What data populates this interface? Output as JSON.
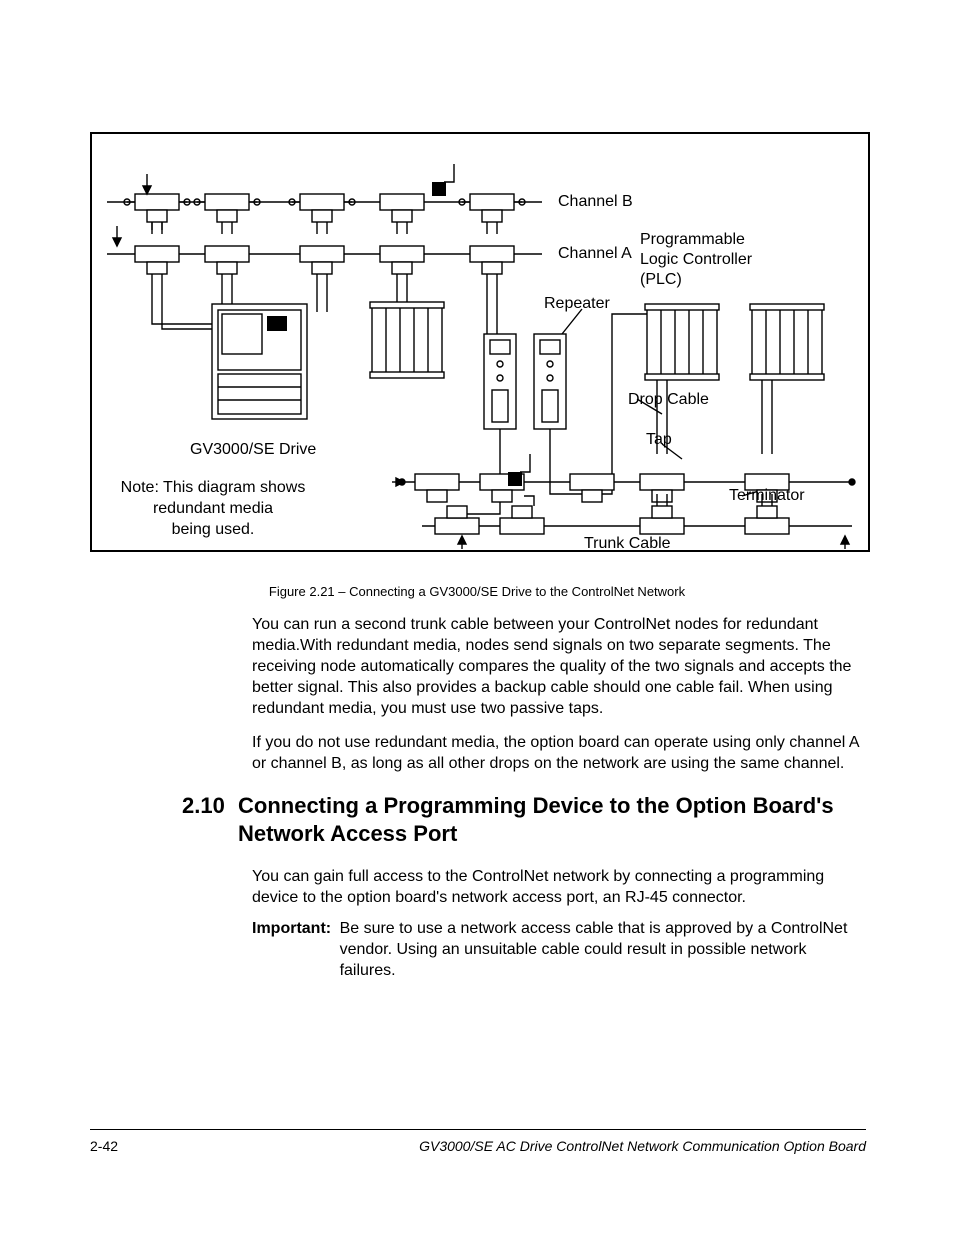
{
  "figure": {
    "labels": {
      "channel_b": "Channel B",
      "channel_a": "Channel A",
      "plc": "Programmable\nLogic Controller\n(PLC)",
      "repeater": "Repeater",
      "drop_cable": "Drop Cable",
      "tap": "Tap",
      "terminator": "Terminator",
      "trunk_cable": "Trunk Cable",
      "drive": "GV3000/SE Drive"
    },
    "note": "Note: This diagram shows\nredundant media\nbeing used.",
    "caption": "Figure 2.21 – Connecting a GV3000/SE Drive to the ControlNet Network"
  },
  "paragraphs": {
    "p1": "You can run a second trunk cable between your ControlNet nodes for redundant media.With redundant media, nodes send signals on two separate segments. The receiving node automatically compares the quality of the two signals and accepts the better signal. This also provides a backup cable should one cable fail. When using redundant media, you must use two passive taps.",
    "p2": "If you do not use redundant media, the option board can operate using only channel A or channel B, as long as all other drops on the network are using the same channel."
  },
  "section": {
    "number": "2.10",
    "title": "Connecting a Programming Device to the Option Board's Network Access Port",
    "p1": "You can gain full access to the ControlNet network by connecting a programming device to the option board's network access port, an RJ-45 connector.",
    "important_label": "Important:",
    "important_body": "Be sure to use a network access cable that is approved by a ControlNet vendor. Using an unsuitable cable could result in possible network failures."
  },
  "footer": {
    "page": "2-42",
    "title": "GV3000/SE AC Drive ControlNet Network Communication Option Board"
  }
}
